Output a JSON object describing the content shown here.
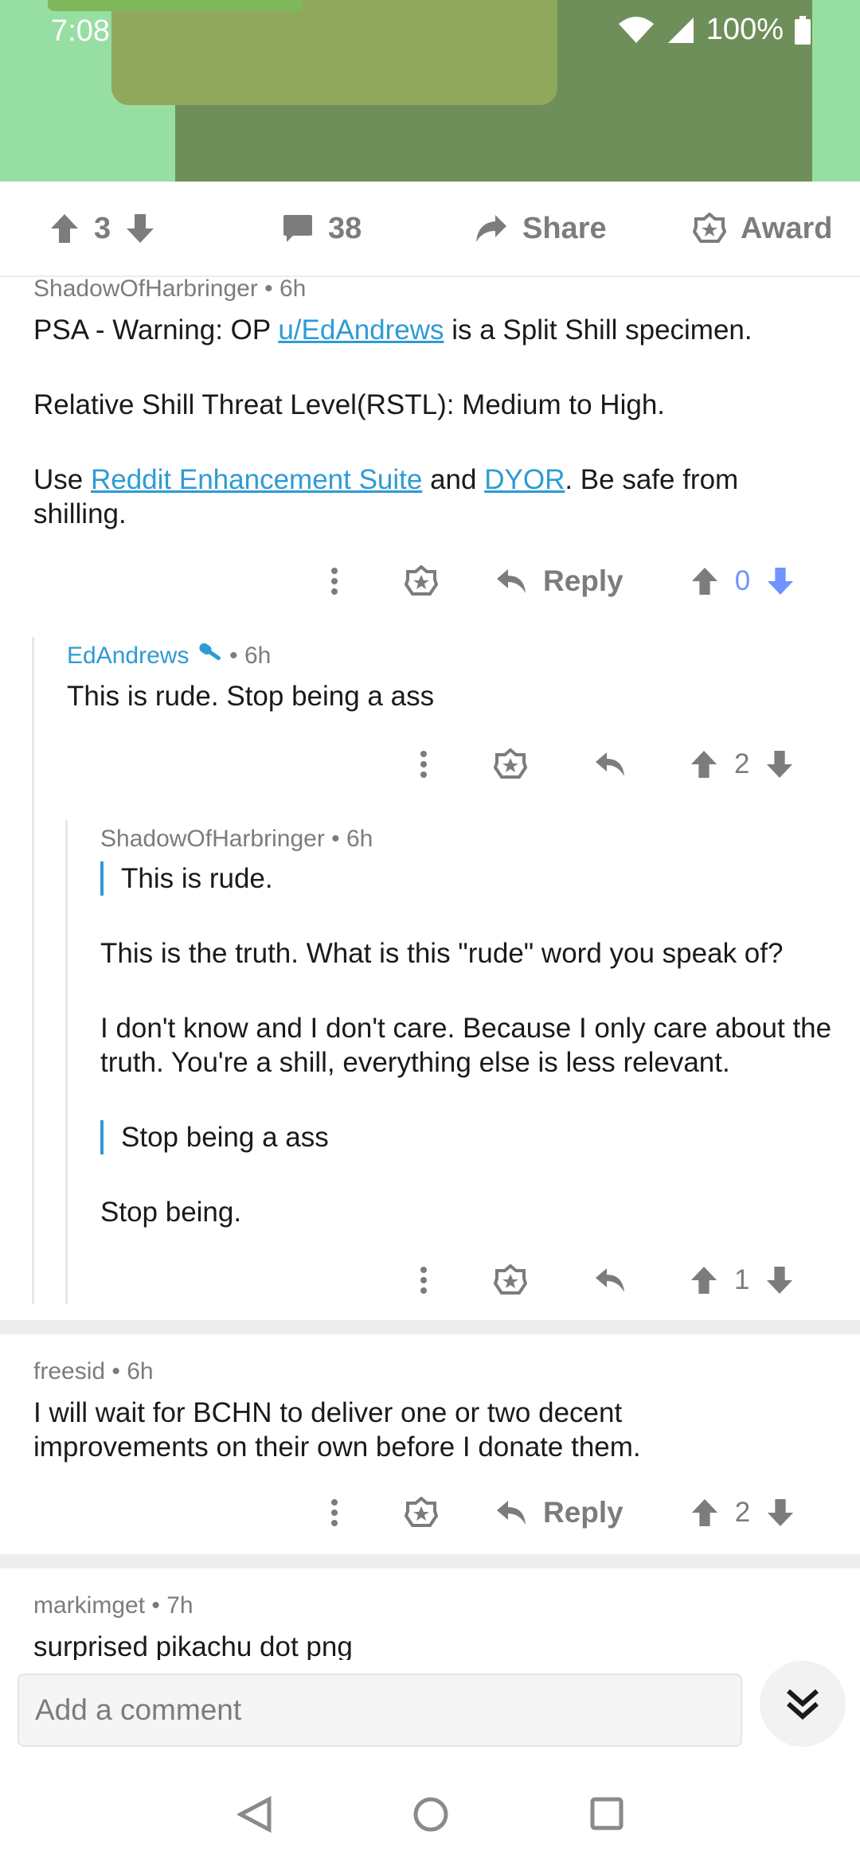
{
  "status_bar": {
    "time": "7:08",
    "battery": "100%"
  },
  "post_actions": {
    "score": "3",
    "comments": "38",
    "share": "Share",
    "award": "Award"
  },
  "comments": [
    {
      "author": "ShadowOfHarbringer",
      "age": "6h",
      "line1_prefix": "PSA - Warning: OP ",
      "line1_link": "u/EdAndrews",
      "line1_suffix": " is a Split Shill specimen.",
      "line2": "Relative Shill Threat Level(RSTL): Medium to High.",
      "line3_prefix": "Use ",
      "line3_link1": "Reddit Enhancement Suite",
      "line3_mid": " and ",
      "line3_link2": "DYOR",
      "line3_suffix": ". Be safe from shilling.",
      "reply": "Reply",
      "score": "0"
    },
    {
      "author": "EdAndrews",
      "age": "6h",
      "text": "This is rude. Stop being a ass",
      "score": "2"
    },
    {
      "author": "ShadowOfHarbringer",
      "age": "6h",
      "quote1": "This is rude.",
      "p1": "This is the truth. What is this \"rude\" word you speak of?",
      "p2": "I don't know and I don't care. Because I only care about the truth. You're a shill, everything else is less relevant.",
      "quote2": "Stop being a ass",
      "p3": "Stop being.",
      "score": "1"
    },
    {
      "author": "freesid",
      "age": "6h",
      "text": "I will wait for BCHN to deliver one or two decent improvements on their own before I donate them.",
      "reply": "Reply",
      "score": "2"
    },
    {
      "author": "markimget",
      "age": "7h",
      "text": "surprised pikachu dot png"
    }
  ],
  "composer": {
    "placeholder": "Add a comment"
  },
  "colors": {
    "accent": "#2e9bd6",
    "downvote_active": "#7193ff",
    "hero_green": "#97dea2"
  }
}
